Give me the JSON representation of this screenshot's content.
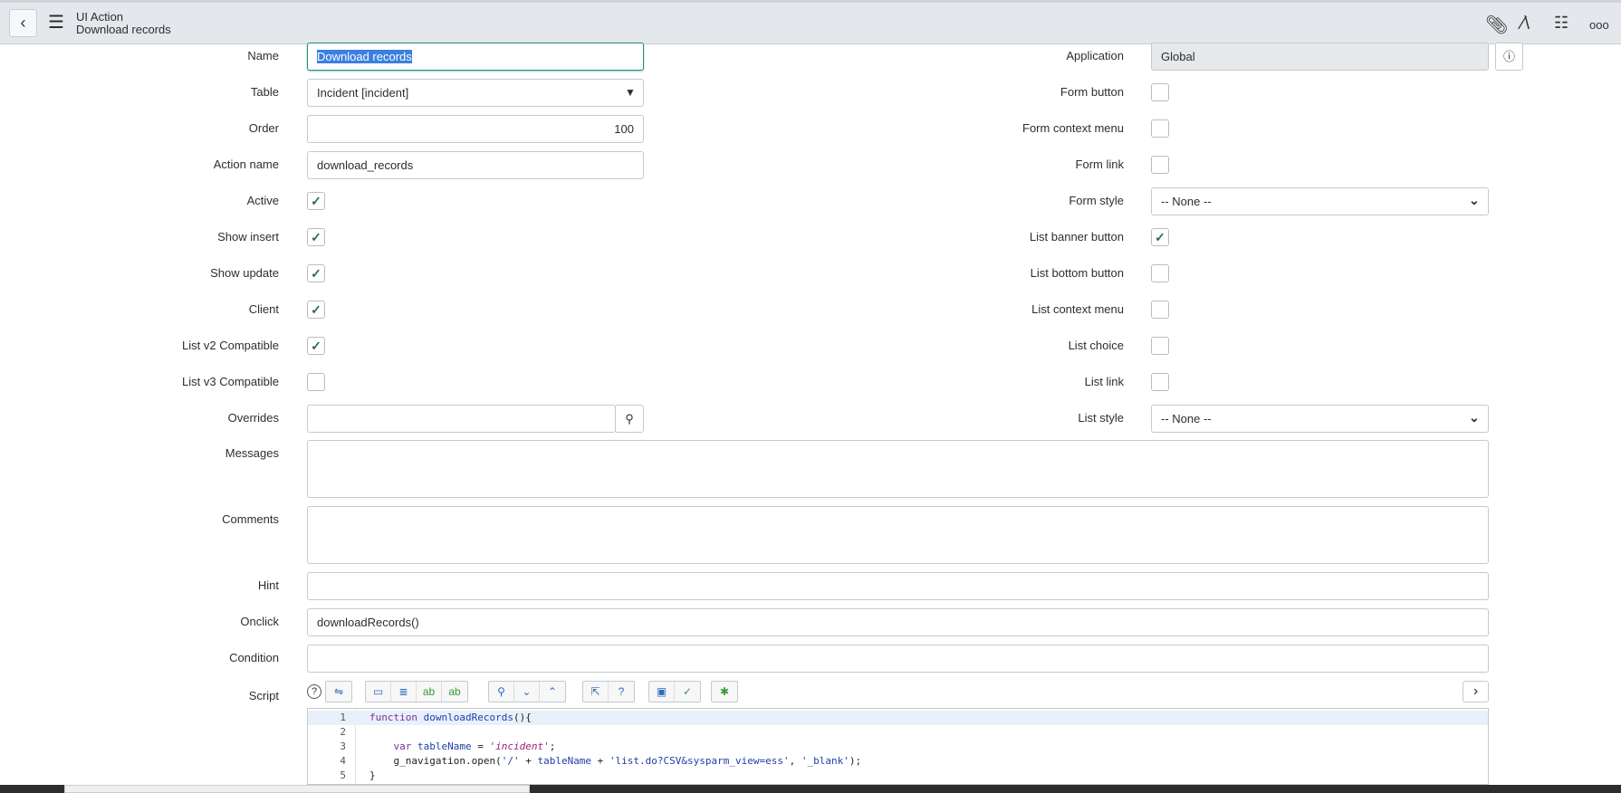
{
  "header": {
    "back_icon": "chevron-left-icon",
    "menu_icon": "hamburger-icon",
    "record_type": "UI Action",
    "record_name": "Download records",
    "icons": [
      "paperclip-icon",
      "activity-icon",
      "sliders-icon",
      "more-icon"
    ],
    "more_glyph": "ooo"
  },
  "left": {
    "name": {
      "label": "Name",
      "value": "Download records"
    },
    "table": {
      "label": "Table",
      "value": "Incident [incident]"
    },
    "order": {
      "label": "Order",
      "value": "100"
    },
    "action_name": {
      "label": "Action name",
      "value": "download_records"
    },
    "active": {
      "label": "Active",
      "checked": true
    },
    "show_insert": {
      "label": "Show insert",
      "checked": true
    },
    "show_update": {
      "label": "Show update",
      "checked": true
    },
    "client": {
      "label": "Client",
      "checked": true
    },
    "list_v2": {
      "label": "List v2 Compatible",
      "checked": true
    },
    "list_v3": {
      "label": "List v3 Compatible",
      "checked": false
    },
    "overrides": {
      "label": "Overrides",
      "value": ""
    }
  },
  "right": {
    "application": {
      "label": "Application",
      "value": "Global"
    },
    "form_button": {
      "label": "Form button",
      "checked": false
    },
    "form_context_menu": {
      "label": "Form context menu",
      "checked": false
    },
    "form_link": {
      "label": "Form link",
      "checked": false
    },
    "form_style": {
      "label": "Form style",
      "value": "-- None --"
    },
    "list_banner_button": {
      "label": "List banner button",
      "checked": true
    },
    "list_bottom_button": {
      "label": "List bottom button",
      "checked": false
    },
    "list_context_menu": {
      "label": "List context menu",
      "checked": false
    },
    "list_choice": {
      "label": "List choice",
      "checked": false
    },
    "list_link": {
      "label": "List link",
      "checked": false
    },
    "list_style": {
      "label": "List style",
      "value": "-- None --"
    }
  },
  "wide": {
    "messages": {
      "label": "Messages",
      "value": ""
    },
    "comments": {
      "label": "Comments",
      "value": ""
    },
    "hint": {
      "label": "Hint",
      "value": ""
    },
    "onclick": {
      "label": "Onclick",
      "value": "downloadRecords()"
    },
    "condition": {
      "label": "Condition",
      "value": ""
    },
    "script": {
      "label": "Script"
    }
  },
  "check_glyph": "✓",
  "code_lines": [
    {
      "n": "1",
      "parts": [
        [
          "kw",
          "function "
        ],
        [
          "fn",
          "downloadRecords"
        ],
        [
          "",
          "(){"
        ]
      ]
    },
    {
      "n": "2",
      "parts": []
    },
    {
      "n": "3",
      "parts": [
        [
          "",
          "    "
        ],
        [
          "kw",
          "var "
        ],
        [
          "fn",
          "tableName"
        ],
        [
          "",
          " = "
        ],
        [
          "st",
          "'incident'"
        ],
        [
          "",
          ";"
        ]
      ]
    },
    {
      "n": "4",
      "parts": [
        [
          "",
          "    g_navigation.open("
        ],
        [
          "s2",
          "'/'"
        ],
        [
          "",
          " + "
        ],
        [
          "fn",
          "tableName"
        ],
        [
          "",
          " + "
        ],
        [
          "s2",
          "'list.do?CSV&sysparm_view=ess'"
        ],
        [
          "",
          ", "
        ],
        [
          "s2",
          "'_blank'"
        ],
        [
          "",
          ");"
        ]
      ]
    },
    {
      "n": "5",
      "parts": [
        [
          "",
          "}"
        ]
      ]
    }
  ]
}
